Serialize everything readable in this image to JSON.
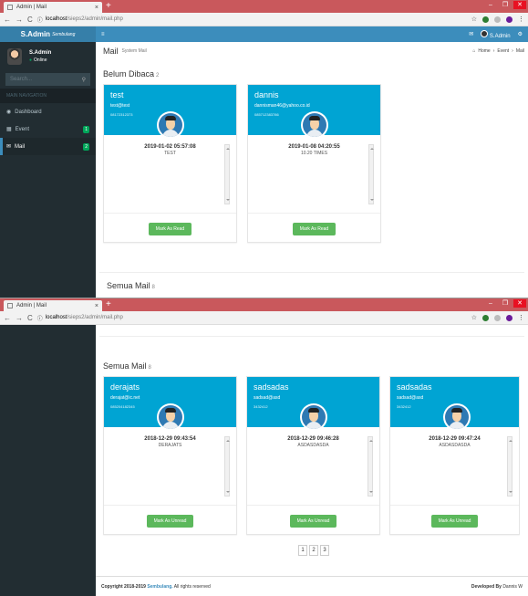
{
  "browser": {
    "tab_title": "Admin | Mail",
    "url_host": "localhost",
    "url_path": "/sieps2/admin/mail.php"
  },
  "app": {
    "brand": "S.Admin",
    "brand_sub": "Sembulang",
    "user_name": "S.Admin",
    "user_status": "Online",
    "search_placeholder": "Search...",
    "nav_header": "MAIN NAVIGATION",
    "menu": [
      {
        "label": "Dashboard"
      },
      {
        "label": "Event",
        "badge": "1"
      },
      {
        "label": "Mail",
        "badge": "2"
      }
    ],
    "top_user": "S.Admin"
  },
  "page": {
    "title": "Mail",
    "subtitle": "System Mail",
    "breadcrumb": [
      "Home",
      "Event",
      "Mail"
    ],
    "unread_title": "Belum Dibaca",
    "unread_count": "2",
    "all_title": "Semua Mail",
    "all_count": "8"
  },
  "unread_cards": [
    {
      "name": "test",
      "email": "test@test",
      "phone": "08172312373",
      "date": "2019-01-02 05:57:08",
      "message": "TEST",
      "button": "Mark As Read"
    },
    {
      "name": "dannis",
      "email": "dannisman46@yahoo.co.id",
      "phone": "085712383786",
      "date": "2019-01-08 04:20:55",
      "message": "10.20 TIMES",
      "button": "Mark As Read"
    }
  ],
  "all_cards": [
    {
      "name": "derajats",
      "email": "derajat@ic.net",
      "phone": "085204182345",
      "date": "2018-12-29 09:43:54",
      "message": "DERAJATS",
      "button": "Mark As Unread"
    },
    {
      "name": "sadsadas",
      "email": "sadsad@asd",
      "phone": "3432412",
      "date": "2018-12-29 09:46:28",
      "message": "ASDASDASDA",
      "button": "Mark As Unread"
    },
    {
      "name": "sadsadas",
      "email": "sadsad@asd",
      "phone": "3432412",
      "date": "2018-12-29 09:47:24",
      "message": "ASDASDASDA",
      "button": "Mark As Unread"
    }
  ],
  "pagination": [
    "1",
    "2",
    "3"
  ],
  "footer": {
    "copyright": "Copyright 2018-2019",
    "brand": "Sembulang.",
    "rights": "All rights reserved",
    "developed": "Developed By",
    "developer": "Dannis W"
  }
}
